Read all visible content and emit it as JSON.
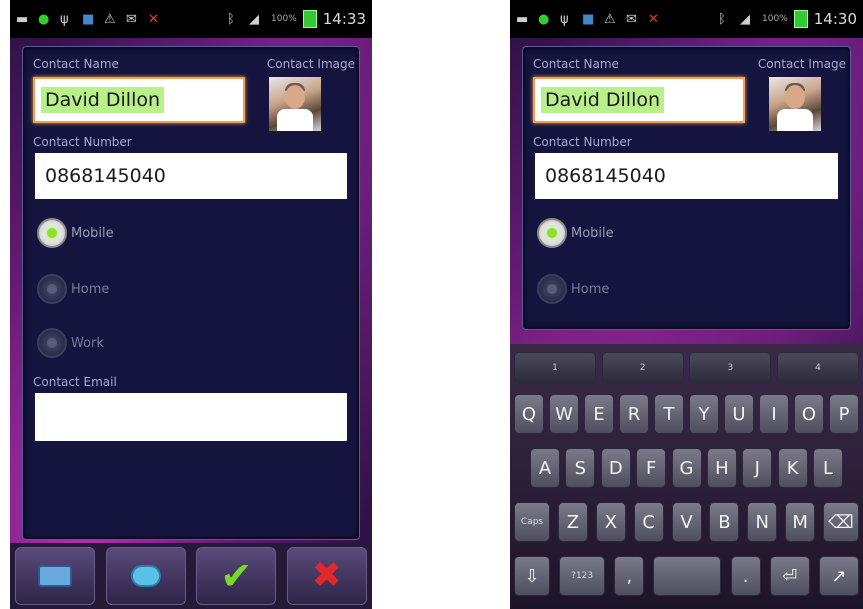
{
  "status_bar": {
    "battery_pct": "100%",
    "time_left": "14:33",
    "time_right": "14:30"
  },
  "form": {
    "contact_name_label": "Contact Name",
    "contact_image_label": "Contact Image",
    "contact_name_value": "David Dillon",
    "contact_number_label": "Contact Number",
    "contact_number_value": "0868145040",
    "radio_options": [
      {
        "label": "Mobile",
        "checked": true
      },
      {
        "label": "Home",
        "checked": false
      },
      {
        "label": "Work",
        "checked": false
      }
    ],
    "contact_email_label": "Contact Email",
    "contact_email_value": ""
  },
  "bottom_bar": {
    "icons": [
      "keyboard-icon",
      "sync-icon",
      "check-icon",
      "cancel-icon"
    ]
  },
  "keyboard": {
    "number_row": [
      "1",
      "2",
      "3",
      "4"
    ],
    "row1": [
      "Q",
      "W",
      "E",
      "R",
      "T",
      "Y",
      "U",
      "I",
      "O",
      "P"
    ],
    "row2": [
      "A",
      "S",
      "D",
      "F",
      "G",
      "H",
      "J",
      "K",
      "L"
    ],
    "row3": [
      "Caps",
      "Z",
      "X",
      "C",
      "V",
      "B",
      "N",
      "M",
      "⌫"
    ],
    "row4": [
      "⇩",
      "?123",
      ",",
      "",
      ".",
      "⏎",
      "↗"
    ]
  },
  "colors": {
    "accent_orange": "#f0a050",
    "highlight_green": "#b8f08a",
    "card_bg": "#14143e"
  }
}
